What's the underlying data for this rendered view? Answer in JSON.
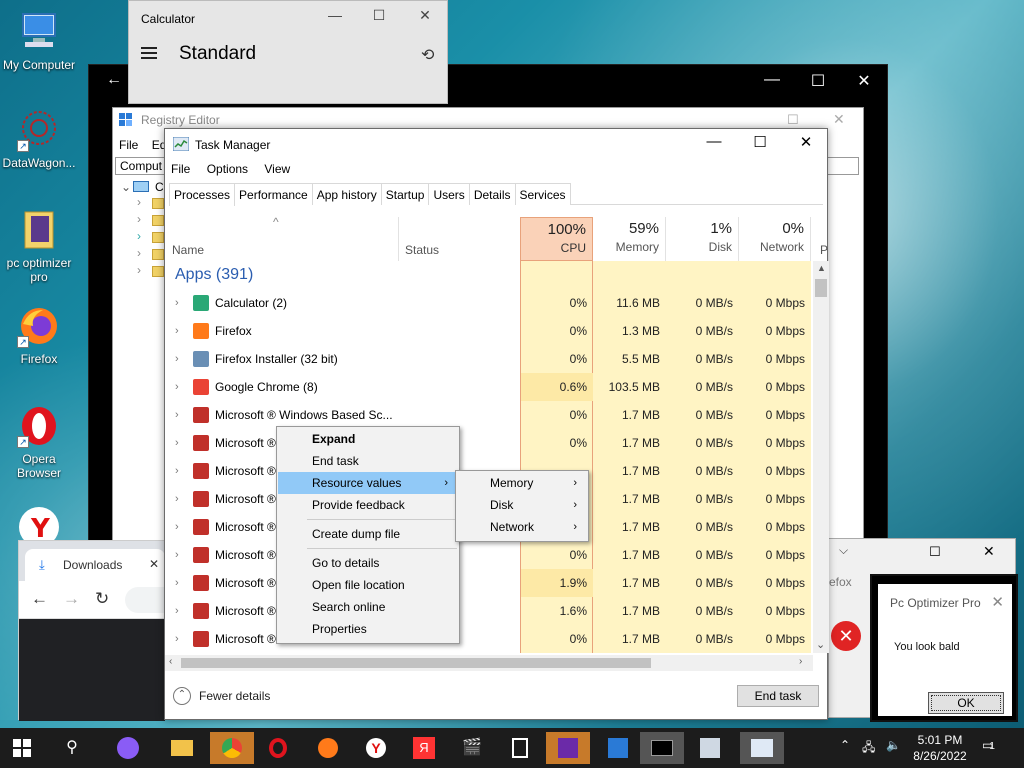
{
  "desktop": {
    "icons": [
      {
        "label": "My Computer"
      },
      {
        "label": "DataWagon..."
      },
      {
        "label": "pc optimizer pro"
      },
      {
        "label": "Firefox"
      },
      {
        "label": "Opera Browser"
      }
    ]
  },
  "calculator": {
    "title": "Calculator",
    "mode": "Standard",
    "minimize": "—",
    "maximize": "☐",
    "close": "✕"
  },
  "darkwindow": {
    "back": "←",
    "minimize": "—",
    "maximize": "☐",
    "close": "✕"
  },
  "registry": {
    "title": "Registry Editor",
    "menu": [
      "File",
      "Ed"
    ],
    "address": "Comput",
    "tree_root": "C"
  },
  "downloads": {
    "tab_label": "Downloads",
    "close": "✕"
  },
  "background_right": {
    "text": "efox"
  },
  "taskmanager": {
    "title": "Task Manager",
    "menu": [
      "File",
      "Options",
      "View"
    ],
    "tabs": [
      "Processes",
      "Performance",
      "App history",
      "Startup",
      "Users",
      "Details",
      "Services"
    ],
    "header": {
      "name": "Name",
      "status": "Status",
      "cpu_pct": "100%",
      "cpu": "CPU",
      "mem_pct": "59%",
      "mem": "Memory",
      "disk_pct": "1%",
      "disk": "Disk",
      "net_pct": "0%",
      "net": "Network",
      "p": "P"
    },
    "group": "Apps (391)",
    "rows": [
      {
        "name": "Calculator (2)",
        "cpu": "0%",
        "mem": "11.6 MB",
        "disk": "0 MB/s",
        "net": "0 Mbps"
      },
      {
        "name": "Firefox",
        "cpu": "0%",
        "mem": "1.3 MB",
        "disk": "0 MB/s",
        "net": "0 Mbps"
      },
      {
        "name": "Firefox Installer (32 bit)",
        "cpu": "0%",
        "mem": "5.5 MB",
        "disk": "0 MB/s",
        "net": "0 Mbps"
      },
      {
        "name": "Google Chrome (8)",
        "cpu": "0.6%",
        "mem": "103.5 MB",
        "disk": "0 MB/s",
        "net": "0 Mbps"
      },
      {
        "name": "Microsoft ® Windows Based Sc...",
        "cpu": "0%",
        "mem": "1.7 MB",
        "disk": "0 MB/s",
        "net": "0 Mbps"
      },
      {
        "name": "Microsoft ®",
        "cpu": "0%",
        "mem": "1.7 MB",
        "disk": "0 MB/s",
        "net": "0 Mbps"
      },
      {
        "name": "Microsoft ®",
        "cpu": "",
        "mem": "1.7 MB",
        "disk": "0 MB/s",
        "net": "0 Mbps"
      },
      {
        "name": "Microsoft ®",
        "cpu": "",
        "mem": "1.7 MB",
        "disk": "0 MB/s",
        "net": "0 Mbps"
      },
      {
        "name": "Microsoft ®",
        "cpu": "",
        "mem": "1.7 MB",
        "disk": "0 MB/s",
        "net": "0 Mbps"
      },
      {
        "name": "Microsoft ®",
        "cpu": "0%",
        "mem": "1.7 MB",
        "disk": "0 MB/s",
        "net": "0 Mbps"
      },
      {
        "name": "Microsoft ®",
        "cpu": "1.9%",
        "mem": "1.7 MB",
        "disk": "0 MB/s",
        "net": "0 Mbps"
      },
      {
        "name": "Microsoft ®",
        "cpu": "1.6%",
        "mem": "1.7 MB",
        "disk": "0 MB/s",
        "net": "0 Mbps"
      },
      {
        "name": "Microsoft ® Windows Based Sc...",
        "cpu": "0%",
        "mem": "1.7 MB",
        "disk": "0 MB/s",
        "net": "0 Mbps"
      }
    ],
    "fewer_details": "Fewer details",
    "end_task": "End task"
  },
  "context_menu": {
    "items": [
      "Expand",
      "End task",
      "Resource values",
      "Provide feedback",
      "Create dump file",
      "Go to details",
      "Open file location",
      "Search online",
      "Properties"
    ],
    "submenu": [
      "Memory",
      "Disk",
      "Network"
    ]
  },
  "popup": {
    "title": "Pc Optimizer Pro",
    "message": "You look bald",
    "ok": "OK"
  },
  "taskbar": {
    "time": "5:01 PM",
    "date": "8/26/2022",
    "notif_count": "1"
  },
  "colors": {
    "cpu_header": "#fad2b8",
    "cell_light": "#fff4c4",
    "cell_mid": "#fde9a6",
    "highlight": "#91c9f7"
  }
}
